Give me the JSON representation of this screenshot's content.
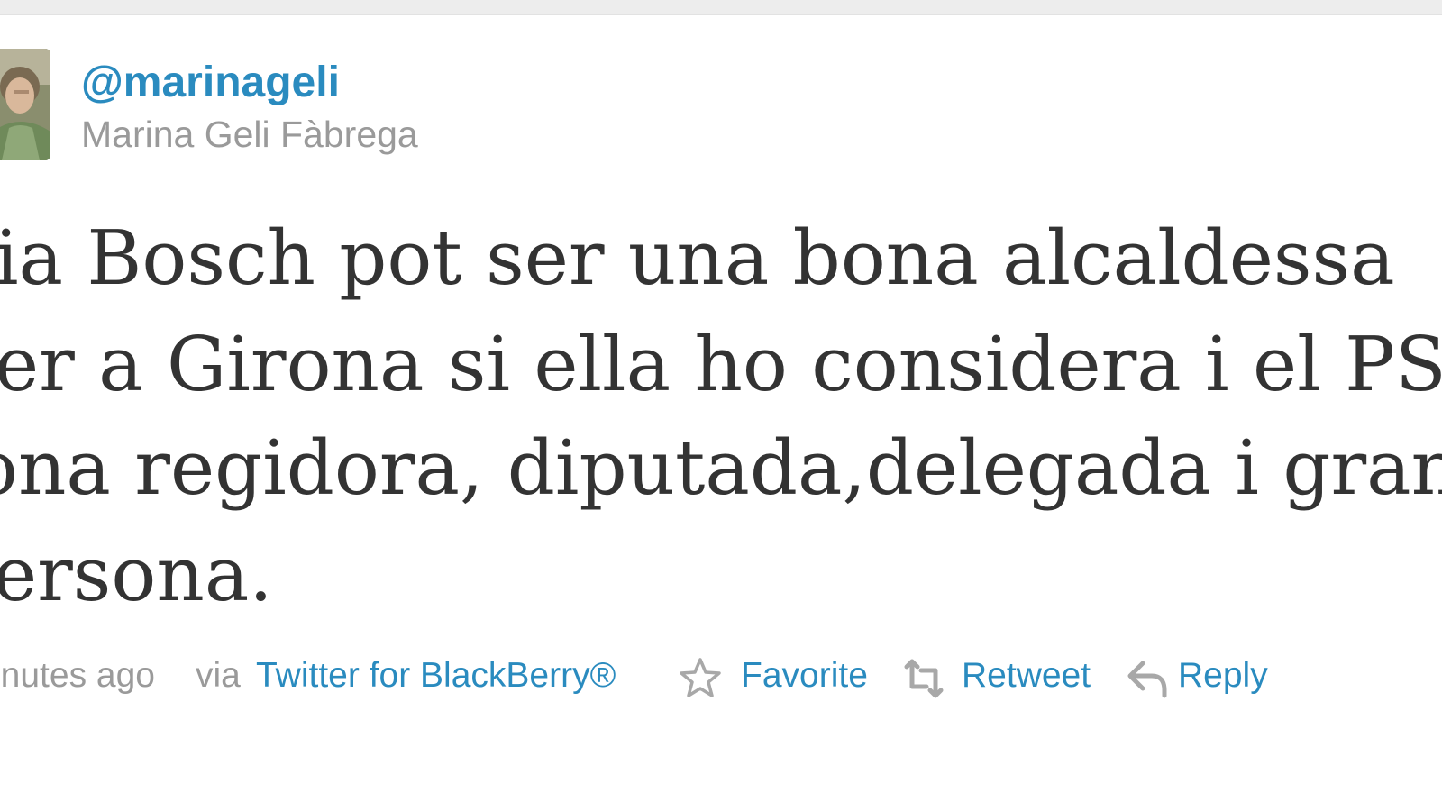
{
  "tweet": {
    "handle": "@marinageli",
    "full_name": "Marina Geli Fàbrega",
    "text_lines": [
      "ia Bosch pot ser una bona alcaldessa",
      "er a Girona si ella ho considera i el PSC",
      "ona regidora, diputada,delegada i gran",
      "ersona."
    ],
    "timestamp": "inutes ago",
    "via_label": "via",
    "source": "Twitter for BlackBerry®"
  },
  "actions": {
    "favorite": "Favorite",
    "retweet": "Retweet",
    "reply": "Reply"
  },
  "icons": {
    "favorite": "star-icon",
    "retweet": "retweet-icon",
    "reply": "reply-icon"
  },
  "colors": {
    "link": "#2a8bbf",
    "muted_text": "#9a9a9a",
    "tweet_text": "#333333",
    "icon_gray": "#a8a8a8",
    "background": "#ffffff"
  }
}
